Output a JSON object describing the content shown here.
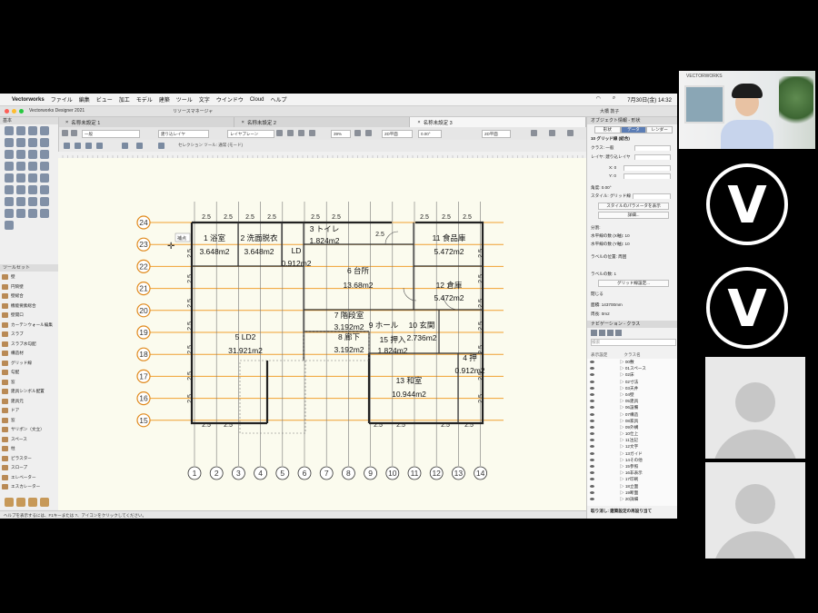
{
  "app": {
    "name": "Vectorworks",
    "window_title": "Vectorworks Designer 2021",
    "menus": [
      "ファイル",
      "編集",
      "ビュー",
      "加工",
      "モデル",
      "建築",
      "ツール",
      "文字",
      "ウインドウ",
      "Cloud",
      "ヘルプ"
    ],
    "clock": "7月30日(金)  14:32",
    "user": "大橋 敦子",
    "resource_manager": "リソースマネージャ"
  },
  "doc_tabs": [
    "名称未設定 1",
    "名称未設定 2",
    "名称未設定 3"
  ],
  "toolbar": {
    "class_value": "一般",
    "layer_value": "建り込レイヤ",
    "view_value": "レイヤプレーン",
    "zoom": "39%",
    "plane": "2D平面",
    "angle": "0.00°",
    "render": "2D平面",
    "selection_hint": "セレクション ツール: 通常 (モード)"
  },
  "palettes": {
    "basic_title": "基本",
    "toolsets_title": "ツールセット",
    "tools": [
      "壁",
      "円筒壁",
      "壁総合",
      "機能要素総合",
      "壁開口",
      "カーテンウォール編集",
      "スラブ",
      "スラブ水勾配",
      "構造材",
      "グリッド線",
      "勾配",
      "窓",
      "建具シンボル配置",
      "建具元",
      "ドア",
      "窓",
      "サリポン（文立）",
      "スペース",
      "柱",
      "ピラスター",
      "スロープ",
      "エレベーター",
      "エスカレーター"
    ]
  },
  "status": "ヘルプを表示するには、F1キーまたは ?、アイコンをクリックしてください。",
  "plan": {
    "rooms": [
      {
        "no": "1",
        "name": "浴室",
        "area": "3.648m2"
      },
      {
        "no": "2",
        "name": "洗面脱衣",
        "area": "3.648m2"
      },
      {
        "no": "3",
        "name": "トイレ",
        "area": "1.824m2"
      },
      {
        "no": "",
        "name": "LD",
        "area": "0.912m2"
      },
      {
        "no": "6",
        "name": "台所",
        "area": "13.68m2"
      },
      {
        "no": "11",
        "name": "食品庫",
        "area": "5.472m2"
      },
      {
        "no": "12",
        "name": "倉庫",
        "area": "5.472m2"
      },
      {
        "no": "7",
        "name": "階段室",
        "area": "3.192m2"
      },
      {
        "no": "8",
        "name": "廊下",
        "area": "3.192m2"
      },
      {
        "no": "",
        "name": "9 ホール",
        "area": ""
      },
      {
        "no": "10",
        "name": "玄関",
        "area": "2.736m2"
      },
      {
        "no": "15",
        "name": "押入",
        "area": "1.824m2"
      },
      {
        "no": "5",
        "name": "LD2",
        "area": "31.921m2"
      },
      {
        "no": "13",
        "name": "和室",
        "area": "10.944m2"
      },
      {
        "no": "4",
        "name": "押",
        "area": "0.912m2"
      }
    ],
    "row_grid": [
      "24",
      "23",
      "22",
      "21",
      "20",
      "19",
      "18",
      "17",
      "16",
      "15"
    ],
    "col_grid": [
      "1",
      "2",
      "3",
      "4",
      "5",
      "6",
      "7",
      "8",
      "9",
      "10",
      "11",
      "12",
      "13",
      "14"
    ],
    "dim_label": "2.5",
    "tag": "補点"
  },
  "obj_info": {
    "title": "オブジェクト情報 - 形状",
    "tabs": [
      "形状",
      "データ",
      "レンダー"
    ],
    "object": "10 グリッド線 (結合)",
    "fields": [
      {
        "label": "クラス:",
        "value": "一般"
      },
      {
        "label": "レイヤ:",
        "value": "建り込レイヤ"
      },
      {
        "label": "X:",
        "value": "0"
      },
      {
        "label": "Y:",
        "value": "0"
      },
      {
        "label": "角度:",
        "value": "0.00°"
      },
      {
        "label": "スタイル:",
        "value": "グリッド線"
      },
      {
        "label": "分割:",
        "value": ""
      },
      {
        "label": "水平線の数 (X軸):",
        "value": "10"
      },
      {
        "label": "水平線の数 (Y軸):",
        "value": "10"
      },
      {
        "label": "ラベルの位置:",
        "value": "周囲"
      },
      {
        "label": "ラベルの数:",
        "value": "1"
      },
      {
        "label": "面積:",
        "value": "143700mm"
      },
      {
        "label": "周長:",
        "value": "0m2"
      }
    ],
    "buttons": [
      "スタイルのパラメータを表示",
      "詳細...",
      "グリッド線設定...",
      "閉じる"
    ]
  },
  "navigation": {
    "title": "ナビゲーション - クラス",
    "show_label": "表示設定",
    "class_label": "クラス名",
    "search_placeholder": "検索",
    "classes": [
      "00敷",
      "01スペース",
      "02床",
      "02寸法",
      "03天井",
      "04壁",
      "05建具",
      "06設備",
      "07構造",
      "08家具",
      "09外構",
      "10仕上",
      "11注記",
      "12文字",
      "13ガイド",
      "14その他",
      "15参照",
      "16非表示",
      "17印刷",
      "18立面",
      "19断面",
      "20詳細"
    ],
    "footer": "取り消し: 建築設定の再設り当て"
  },
  "video": {
    "top_label": "VECTORWORKS"
  }
}
